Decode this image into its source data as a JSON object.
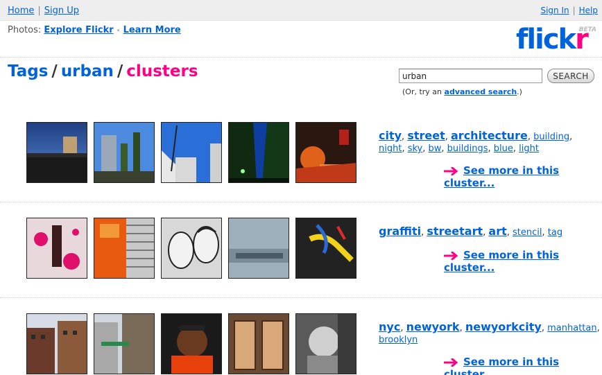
{
  "topbar": {
    "home": "Home",
    "signup": "Sign Up",
    "signin": "Sign In",
    "help": "Help"
  },
  "explore": {
    "prefix": "Photos:",
    "explore_link": "Explore Flickr",
    "learn_link": "Learn More"
  },
  "logo": {
    "part1": "flick",
    "part2": "r",
    "beta": "BETA"
  },
  "breadcrumb": {
    "tags": "Tags",
    "tag": "urban",
    "current": "clusters"
  },
  "search": {
    "value": "urban",
    "button": "SEARCH",
    "hint_prefix": "(Or, try an",
    "hint_link": "advanced search",
    "hint_suffix": ".)"
  },
  "clusters": [
    {
      "tags_big": [
        "city",
        "street",
        "architecture"
      ],
      "tags_small": [
        "building",
        "night",
        "sky",
        "bw",
        "buildings",
        "blue",
        "light"
      ],
      "see_more": "See more in this cluster..."
    },
    {
      "tags_big": [
        "graffiti",
        "streetart",
        "art"
      ],
      "tags_small": [
        "stencil",
        "tag"
      ],
      "see_more": "See more in this cluster..."
    },
    {
      "tags_big": [
        "nyc",
        "newyork",
        "newyorkcity"
      ],
      "tags_small": [
        "manhattan",
        "brooklyn"
      ],
      "see_more": "See more in this cluster..."
    }
  ],
  "colors": {
    "link": "#0063dc",
    "accent": "#ff0084"
  }
}
